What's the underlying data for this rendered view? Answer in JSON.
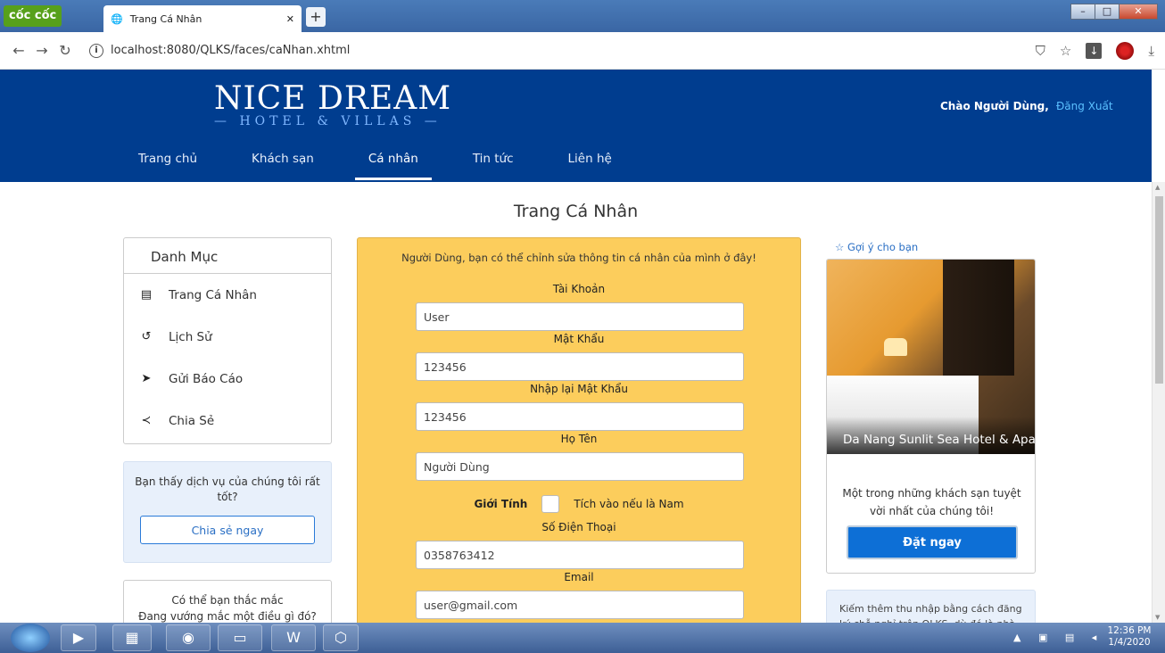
{
  "browser": {
    "brand": "cốc cốc",
    "tab_title": "Trang Cá Nhân",
    "url": "localhost:8080/QLKS/faces/caNhan.xhtml"
  },
  "header": {
    "logo_main": "NICE DREAM",
    "logo_sub": "— HOTEL & VILLAS —",
    "greeting": "Chào Người Dùng,",
    "logout": "Đăng Xuất",
    "nav": [
      "Trang chủ",
      "Khách sạn",
      "Cá nhân",
      "Tin tức",
      "Liên hệ"
    ],
    "active_nav": "Cá nhân"
  },
  "page": {
    "title": "Trang Cá Nhân"
  },
  "menu": {
    "heading": "Danh Mục",
    "items": [
      {
        "label": "Trang Cá Nhân",
        "icon": "id-card-icon"
      },
      {
        "label": "Lịch Sử",
        "icon": "history-icon"
      },
      {
        "label": "Gửi Báo Cáo",
        "icon": "send-icon"
      },
      {
        "label": "Chia Sẻ",
        "icon": "share-icon"
      }
    ]
  },
  "share_box": {
    "text": "Bạn thấy dịch vụ của chúng tôi rất tốt?",
    "button": "Chia sẻ ngay"
  },
  "question_box": {
    "line1": "Có thể bạn thắc mắc",
    "line2": "Đang vướng mắc một điều gì đó?"
  },
  "form": {
    "intro": "Người Dùng, bạn có thể chỉnh sửa thông tin cá nhân của mình ở đây!",
    "username_label": "Tài Khoản",
    "username": "User",
    "password_label": "Mật Khẩu",
    "password": "123456",
    "repassword_label": "Nhập lại Mật Khẩu",
    "repassword": "123456",
    "fullname_label": "Họ Tên",
    "fullname": "Người Dùng",
    "gender_label": "Giới Tính",
    "gender_hint": "Tích vào nếu là Nam",
    "gender_male": false,
    "phone_label": "Số Điện Thoại",
    "phone": "0358763412",
    "email_label": "Email",
    "email": "user@gmail.com"
  },
  "suggestion": {
    "heading": "☆ Gợi ý cho bạn",
    "hotel_name": "Da Nang Sunlit Sea Hotel & Apartment",
    "description": "Một trong những khách sạn tuyệt vời nhất của chúng tôi!",
    "button": "Đặt ngay"
  },
  "earn_box": {
    "text": "Kiếm thêm thu nhập bằng cách đăng ký chỗ nghỉ trên QLKS, dù đó là nhà"
  },
  "taskbar": {
    "time": "12:36 PM",
    "date": "1/4/2020"
  },
  "colors": {
    "header": "#003d8f",
    "form_bg": "#fccd5c",
    "accent": "#0d6fd6"
  }
}
